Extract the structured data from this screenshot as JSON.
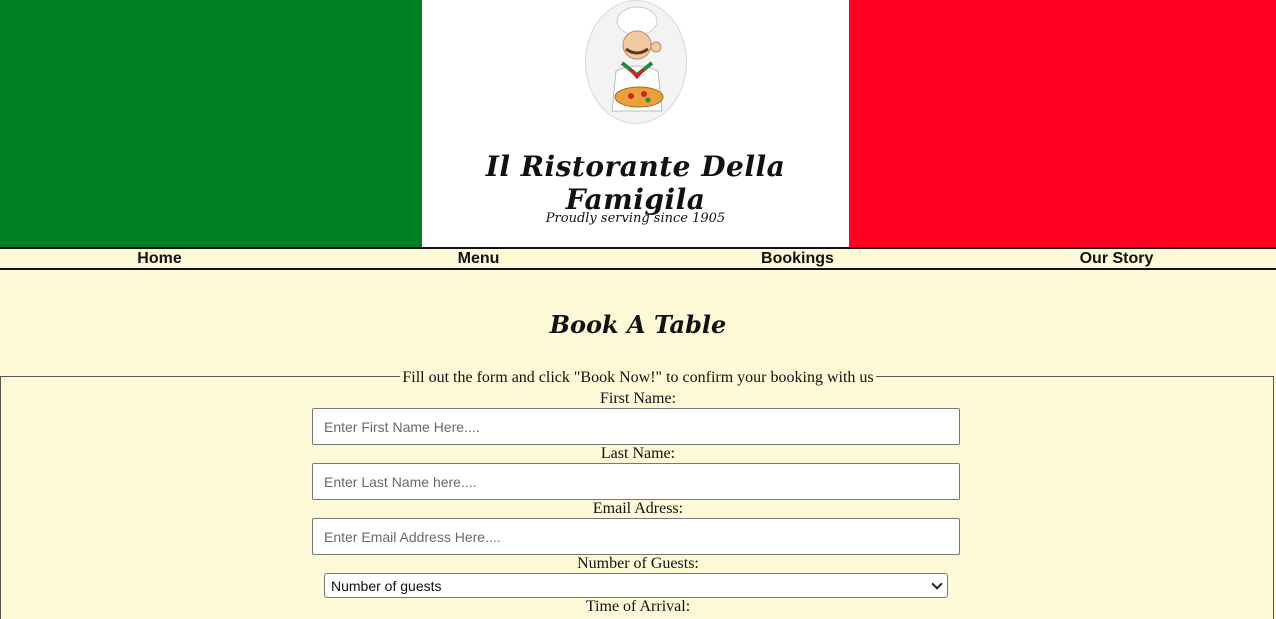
{
  "site": {
    "title": "Il Ristorante Della Famigila",
    "tagline": "Proudly serving since 1905",
    "logo": "chef-with-pizza-logo"
  },
  "colors": {
    "green": "#008026",
    "white": "#ffffff",
    "red": "#ff0022",
    "background": "#fef9d7"
  },
  "nav": {
    "items": [
      {
        "label": "Home"
      },
      {
        "label": "Menu"
      },
      {
        "label": "Bookings"
      },
      {
        "label": "Our Story"
      }
    ]
  },
  "page": {
    "heading": "Book A Table"
  },
  "form": {
    "legend": "Fill out the form and click \"Book Now!\" to confirm your booking with us",
    "first_name": {
      "label": "First Name:",
      "placeholder": "Enter First Name Here...."
    },
    "last_name": {
      "label": "Last Name:",
      "placeholder": "Enter Last Name here...."
    },
    "email": {
      "label": "Email Adress:",
      "placeholder": "Enter Email Address Here...."
    },
    "guests": {
      "label": "Number of Guests:",
      "selected": "Number of guests"
    },
    "arrival": {
      "label": "Time of Arrival:"
    }
  }
}
